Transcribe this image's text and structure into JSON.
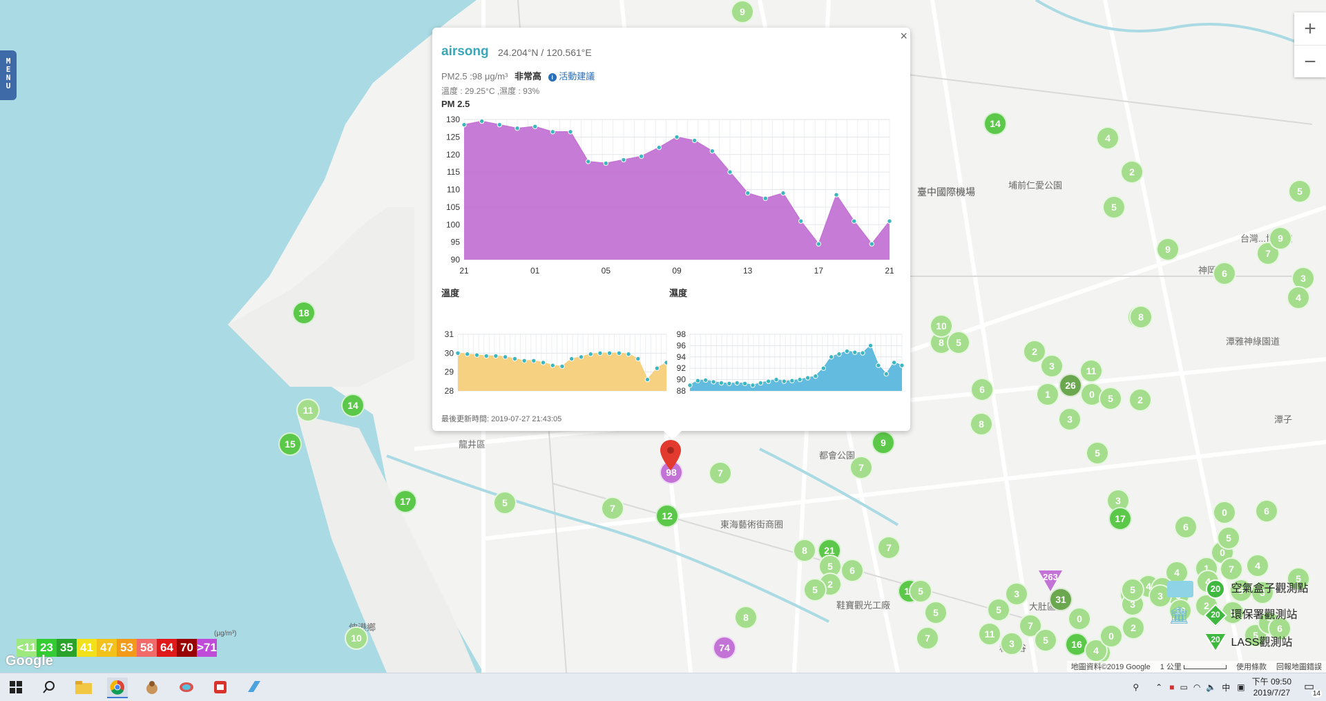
{
  "menu_label": "MENU",
  "zoom": {
    "in": "+",
    "out": "−"
  },
  "popup": {
    "close": "×",
    "site_name": "airsong",
    "coordinates": "24.204°N / 120.561°E",
    "pm_text": "PM2.5 :98 μg/m³",
    "pm_level": "非常高",
    "advice_link": "活動建議",
    "temp_humidity_text": "溫度 : 29.25°C ,濕度 : 93%",
    "updated_text": "最後更新時間: 2019-07-27 21:43:05"
  },
  "chart_data": [
    {
      "type": "area",
      "title": "PM 2.5",
      "x_ticks": [
        "21",
        "01",
        "05",
        "09",
        "13",
        "17",
        "21"
      ],
      "ylim": [
        90,
        130
      ],
      "y_ticks": [
        90,
        95,
        100,
        105,
        110,
        115,
        120,
        125,
        130
      ],
      "color": "#c374d4",
      "values": [
        128.5,
        129.5,
        128.5,
        127.5,
        128,
        126.5,
        126.5,
        118,
        117.5,
        118.5,
        119.5,
        122,
        125,
        124,
        121,
        115,
        109,
        107.5,
        109,
        101,
        94.5,
        108.5,
        101,
        94.5,
        101
      ]
    },
    {
      "type": "area",
      "title": "溫度",
      "ylim": [
        28,
        31
      ],
      "y_ticks": [
        28,
        29,
        30,
        31
      ],
      "color": "#f5cf7a",
      "values": [
        30,
        29.95,
        29.9,
        29.85,
        29.85,
        29.8,
        29.7,
        29.6,
        29.6,
        29.5,
        29.35,
        29.3,
        29.7,
        29.8,
        29.95,
        30.0,
        30.0,
        30.0,
        29.95,
        29.7,
        28.6,
        29.2,
        29.5
      ]
    },
    {
      "type": "area",
      "title": "濕度",
      "ylim": [
        88,
        98
      ],
      "y_ticks": [
        88,
        90,
        92,
        94,
        96,
        98
      ],
      "color": "#5bb8dd",
      "values": [
        89,
        89.8,
        89.9,
        89.6,
        89.4,
        89.3,
        89.4,
        89.3,
        89,
        89.4,
        89.7,
        90,
        89.7,
        89.8,
        90,
        90.3,
        90.6,
        92,
        94,
        94.5,
        95,
        94.8,
        94.7,
        96,
        92.5,
        91,
        93,
        92.5
      ]
    }
  ],
  "markers": [
    {
      "label": "9",
      "kind": "light"
    },
    {
      "label": "14",
      "kind": "green"
    },
    {
      "label": "4",
      "kind": "light"
    },
    {
      "label": "2",
      "kind": "light"
    },
    {
      "label": "5",
      "kind": "light"
    },
    {
      "label": "5",
      "kind": "light"
    },
    {
      "label": "9",
      "kind": "light"
    },
    {
      "label": "7",
      "kind": "light"
    },
    {
      "label": "9",
      "kind": "light"
    },
    {
      "label": "6",
      "kind": "light"
    },
    {
      "label": "3",
      "kind": "light"
    },
    {
      "label": "4",
      "kind": "light"
    },
    {
      "label": "18",
      "kind": "green"
    },
    {
      "label": "11",
      "kind": "light"
    },
    {
      "label": "14",
      "kind": "green"
    },
    {
      "label": "15",
      "kind": "green"
    },
    {
      "label": "17",
      "kind": "green"
    },
    {
      "label": "5",
      "kind": "light"
    },
    {
      "label": "7",
      "kind": "light"
    },
    {
      "label": "12",
      "kind": "green"
    },
    {
      "label": "98",
      "kind": "purple"
    },
    {
      "label": "7",
      "kind": "light"
    },
    {
      "label": "8",
      "kind": "light"
    },
    {
      "label": "10",
      "kind": "light"
    },
    {
      "label": "5",
      "kind": "light"
    },
    {
      "label": "10",
      "kind": "light"
    },
    {
      "label": "8",
      "kind": "light"
    },
    {
      "label": "2",
      "kind": "light"
    },
    {
      "label": "3",
      "kind": "light"
    },
    {
      "label": "11",
      "kind": "light"
    },
    {
      "label": "0",
      "kind": "light"
    },
    {
      "label": "26",
      "kind": "olive"
    },
    {
      "label": "6",
      "kind": "light"
    },
    {
      "label": "1",
      "kind": "light"
    },
    {
      "label": "5",
      "kind": "light"
    },
    {
      "label": "2",
      "kind": "light"
    },
    {
      "label": "3",
      "kind": "light"
    },
    {
      "label": "8",
      "kind": "light"
    },
    {
      "label": "9",
      "kind": "green"
    },
    {
      "label": "7",
      "kind": "light"
    },
    {
      "label": "5",
      "kind": "light"
    },
    {
      "label": "3",
      "kind": "light"
    },
    {
      "label": "17",
      "kind": "green"
    },
    {
      "label": "6",
      "kind": "light"
    },
    {
      "label": "0",
      "kind": "light"
    },
    {
      "label": "6",
      "kind": "light"
    },
    {
      "label": "8",
      "kind": "light"
    },
    {
      "label": "21",
      "kind": "green"
    },
    {
      "label": "5",
      "kind": "light"
    },
    {
      "label": "7",
      "kind": "light"
    },
    {
      "label": "2",
      "kind": "light"
    },
    {
      "label": "6",
      "kind": "light"
    },
    {
      "label": "5",
      "kind": "light"
    },
    {
      "label": "12",
      "kind": "green"
    },
    {
      "label": "5",
      "kind": "light"
    },
    {
      "label": "5",
      "kind": "light"
    },
    {
      "label": "7",
      "kind": "light"
    },
    {
      "label": "8",
      "kind": "light"
    },
    {
      "label": "74",
      "kind": "purple"
    },
    {
      "label": "10",
      "kind": "light"
    },
    {
      "label": "31",
      "kind": "olive"
    },
    {
      "label": "3",
      "kind": "light"
    },
    {
      "label": "5",
      "kind": "light"
    },
    {
      "label": "7",
      "kind": "light"
    },
    {
      "label": "11",
      "kind": "light"
    },
    {
      "label": "3",
      "kind": "light"
    },
    {
      "label": "5",
      "kind": "light"
    },
    {
      "label": "16",
      "kind": "green"
    },
    {
      "label": "4",
      "kind": "light"
    },
    {
      "label": "0",
      "kind": "light"
    },
    {
      "label": "1",
      "kind": "light"
    },
    {
      "label": "3",
      "kind": "light"
    },
    {
      "label": "4",
      "kind": "light"
    },
    {
      "label": "5",
      "kind": "light"
    },
    {
      "label": "4",
      "kind": "light"
    },
    {
      "label": "2",
      "kind": "light"
    },
    {
      "label": "5",
      "kind": "light"
    },
    {
      "label": "7",
      "kind": "light"
    },
    {
      "label": "6",
      "kind": "light"
    },
    {
      "label": "3",
      "kind": "light"
    },
    {
      "label": "0",
      "kind": "light"
    },
    {
      "label": "5",
      "kind": "light"
    },
    {
      "label": "4",
      "kind": "light"
    },
    {
      "label": "5",
      "kind": "light"
    },
    {
      "label": "6",
      "kind": "light"
    },
    {
      "label": "7",
      "kind": "light"
    },
    {
      "label": "1",
      "kind": "light"
    },
    {
      "label": "3",
      "kind": "light"
    },
    {
      "label": "4",
      "kind": "light"
    },
    {
      "label": "10",
      "kind": "light"
    },
    {
      "label": "1",
      "kind": "light"
    },
    {
      "label": "3",
      "kind": "light"
    },
    {
      "label": "2",
      "kind": "light"
    },
    {
      "label": "4",
      "kind": "light"
    },
    {
      "label": "0",
      "kind": "light"
    },
    {
      "label": "5",
      "kind": "light"
    }
  ],
  "triangle_marker": "263",
  "place_labels": [
    "臺中國際機場",
    "埔前仁愛公園",
    "神岡區",
    "台灣...博物館",
    "潭雅神綠園道",
    "龍井區",
    "都會公園",
    "東海藝術街商圈",
    "鞋寶觀光工廠",
    "大肚區",
    "秋紅谷",
    "伸港鄉",
    "潭子"
  ],
  "legend": {
    "unit": "(μg/m³)",
    "items": [
      {
        "label": "<11",
        "color": "#9ee880"
      },
      {
        "label": "23",
        "color": "#33cc33"
      },
      {
        "label": "35",
        "color": "#29a329"
      },
      {
        "label": "41",
        "color": "#f2e01a"
      },
      {
        "label": "47",
        "color": "#f2c21a"
      },
      {
        "label": "53",
        "color": "#f29a1a"
      },
      {
        "label": "58",
        "color": "#f26a6a"
      },
      {
        "label": "64",
        "color": "#e01a1a"
      },
      {
        "label": "70",
        "color": "#990000"
      },
      {
        "label": ">71",
        "color": "#c04bd8"
      }
    ]
  },
  "google_logo": "Google",
  "map_legend": {
    "airbox": "空氣盒子觀測點",
    "epa": "環保署觀測站",
    "lass": "LASS觀測站",
    "sample_value": "20"
  },
  "attribution": {
    "data": "地圖資料©2019 Google",
    "scale": "1 公里",
    "terms": "使用條款",
    "report": "回報地圖錯誤"
  },
  "taskbar": {
    "time": "下午 09:50",
    "date": "2019/7/27",
    "ime": "中",
    "notifications": "14"
  }
}
